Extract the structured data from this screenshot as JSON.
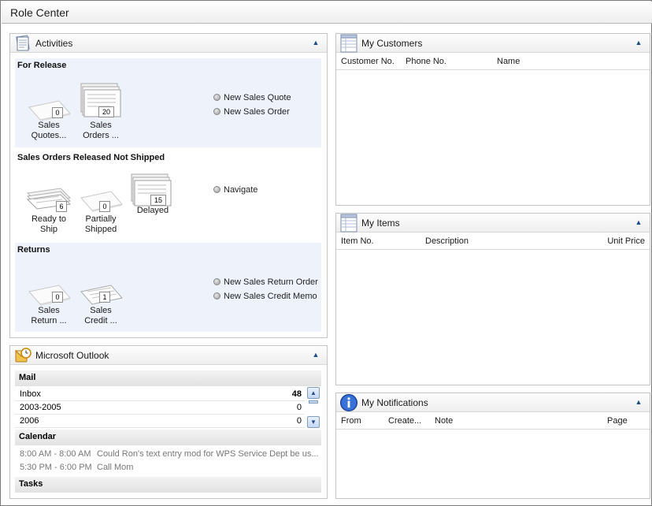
{
  "window": {
    "title": "Role Center"
  },
  "activities": {
    "title": "Activities",
    "groups": [
      {
        "title": "For Release",
        "cues": [
          {
            "count": "0",
            "label": "Sales\nQuotes..."
          },
          {
            "count": "20",
            "label": "Sales\nOrders ..."
          }
        ],
        "actions": [
          "New Sales Quote",
          "New Sales Order"
        ]
      },
      {
        "title": "Sales Orders Released Not Shipped",
        "cues": [
          {
            "count": "6",
            "label": "Ready to\nShip"
          },
          {
            "count": "0",
            "label": "Partially\nShipped"
          },
          {
            "count": "15",
            "label": "Delayed"
          }
        ],
        "actions": [
          "Navigate"
        ]
      },
      {
        "title": "Returns",
        "cues": [
          {
            "count": "0",
            "label": "Sales\nReturn ..."
          },
          {
            "count": "1",
            "label": "Sales\nCredit ..."
          }
        ],
        "actions": [
          "New Sales Return Order",
          "New Sales Credit Memo"
        ]
      }
    ]
  },
  "outlook": {
    "title": "Microsoft Outlook",
    "mail_title": "Mail",
    "folders": [
      {
        "name": "Inbox",
        "count": "48"
      },
      {
        "name": "2003-2005",
        "count": "0"
      },
      {
        "name": "2006",
        "count": "0"
      }
    ],
    "calendar_title": "Calendar",
    "appointments": [
      {
        "time": "8:00 AM - 8:00 AM",
        "subject": "Could Ron's text entry mod for WPS Service Dept be us..."
      },
      {
        "time": "5:30 PM - 6:00 PM",
        "subject": "Call Mom"
      }
    ],
    "tasks_title": "Tasks"
  },
  "customers": {
    "title": "My Customers",
    "columns": [
      "Customer No.",
      "Phone No.",
      "Name"
    ]
  },
  "items": {
    "title": "My Items",
    "columns": [
      "Item No.",
      "Description",
      "Unit Price"
    ]
  },
  "notifications": {
    "title": "My Notifications",
    "columns": [
      "From",
      "Create...",
      "Note",
      "Page"
    ]
  },
  "icons": {
    "collapse": "collapse-up-icon",
    "activities": "activities-stack-icon",
    "outlook": "outlook-icon",
    "list": "list-icon",
    "info": "info-icon",
    "action_bullet": "bullet-icon"
  },
  "colors": {
    "accent": "#1d4e8c",
    "group_bg": "#eef3fb"
  }
}
